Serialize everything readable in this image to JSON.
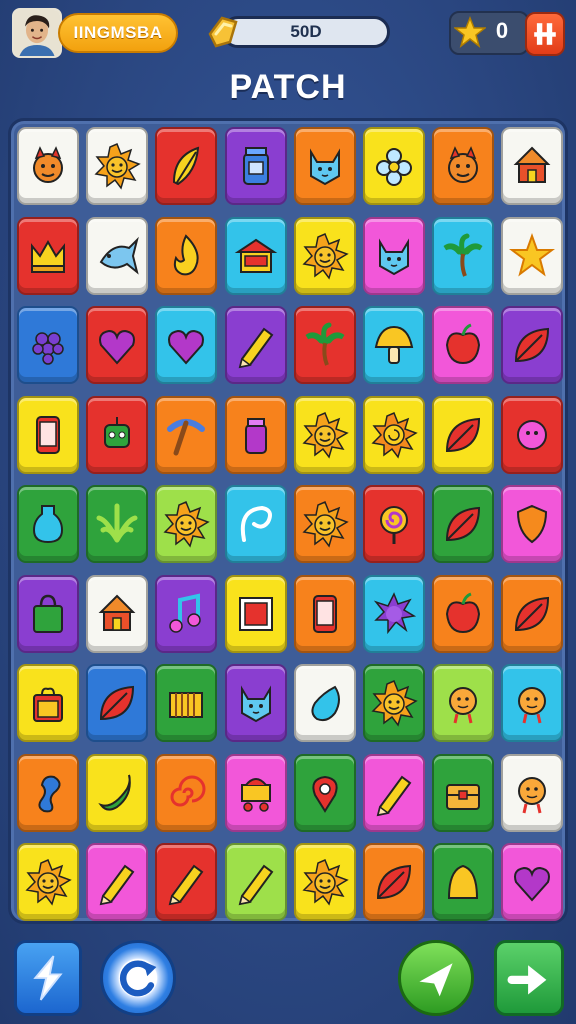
{
  "header": {
    "player_name": "IINGMSBA",
    "coins": "50D",
    "stars": "0",
    "title": "PATCH"
  },
  "colors": {
    "background": "#2c4a86",
    "board": "#3e5d98",
    "name_pill": "#f5ab12",
    "menu_button": "#ef4f22"
  },
  "board": {
    "rows": 9,
    "cols": 8,
    "tiles": [
      [
        "white",
        "devil-face"
      ],
      [
        "white",
        "sun-face"
      ],
      [
        "red",
        "feather"
      ],
      [
        "purple",
        "jar"
      ],
      [
        "orange",
        "cat-face"
      ],
      [
        "yellow",
        "flower"
      ],
      [
        "orange",
        "devil-face"
      ],
      [
        "white",
        "hut"
      ],
      [
        "red",
        "crown"
      ],
      [
        "white",
        "fish"
      ],
      [
        "orange",
        "flame"
      ],
      [
        "cyan",
        "house"
      ],
      [
        "yellow",
        "sun-face"
      ],
      [
        "pink",
        "cat-face"
      ],
      [
        "cyan",
        "palm-tree"
      ],
      [
        "white",
        "star"
      ],
      [
        "blue",
        "grapes"
      ],
      [
        "red",
        "heart"
      ],
      [
        "cyan",
        "heart"
      ],
      [
        "purple",
        "pencil"
      ],
      [
        "red",
        "palm-tree"
      ],
      [
        "cyan",
        "mushroom"
      ],
      [
        "pink",
        "apple"
      ],
      [
        "purple",
        "leaf"
      ],
      [
        "yellow",
        "phone"
      ],
      [
        "red",
        "robot"
      ],
      [
        "orange",
        "pickaxe"
      ],
      [
        "orange",
        "cup"
      ],
      [
        "yellow",
        "sun-face"
      ],
      [
        "yellow",
        "spiral-sun"
      ],
      [
        "yellow",
        "leaf"
      ],
      [
        "red",
        "sun-blob"
      ],
      [
        "green",
        "bottle"
      ],
      [
        "green",
        "palm-leaf"
      ],
      [
        "lime",
        "sun-face"
      ],
      [
        "cyan",
        "swirl"
      ],
      [
        "orange",
        "sun-face"
      ],
      [
        "red",
        "lollipop"
      ],
      [
        "green",
        "leaf"
      ],
      [
        "pink",
        "shield"
      ],
      [
        "purple",
        "bag"
      ],
      [
        "white",
        "hut"
      ],
      [
        "purple",
        "music-note"
      ],
      [
        "yellow",
        "picture"
      ],
      [
        "orange",
        "phone"
      ],
      [
        "cyan",
        "spiky-ball"
      ],
      [
        "orange",
        "apple"
      ],
      [
        "orange",
        "leaf"
      ],
      [
        "yellow",
        "gift"
      ],
      [
        "blue",
        "leaf"
      ],
      [
        "green",
        "piano"
      ],
      [
        "purple",
        "cat-face"
      ],
      [
        "white",
        "drop"
      ],
      [
        "green",
        "sun-face"
      ],
      [
        "lime",
        "face"
      ],
      [
        "cyan",
        "face"
      ],
      [
        "orange",
        "seahorse"
      ],
      [
        "yellow",
        "banana"
      ],
      [
        "orange",
        "spiral"
      ],
      [
        "pink",
        "cart"
      ],
      [
        "green",
        "pin"
      ],
      [
        "pink",
        "pencil"
      ],
      [
        "green",
        "chest"
      ],
      [
        "white",
        "face"
      ],
      [
        "yellow",
        "sun-face"
      ],
      [
        "pink",
        "pencil"
      ],
      [
        "red",
        "pencil"
      ],
      [
        "lime",
        "pencil"
      ],
      [
        "yellow",
        "sun-face"
      ],
      [
        "orange",
        "leaf"
      ],
      [
        "green",
        "bell"
      ],
      [
        "pink",
        "heart"
      ]
    ]
  },
  "controls": {
    "hint": "hint-icon",
    "shuffle": "undo-icon",
    "send": "send-icon",
    "next": "next-icon"
  }
}
